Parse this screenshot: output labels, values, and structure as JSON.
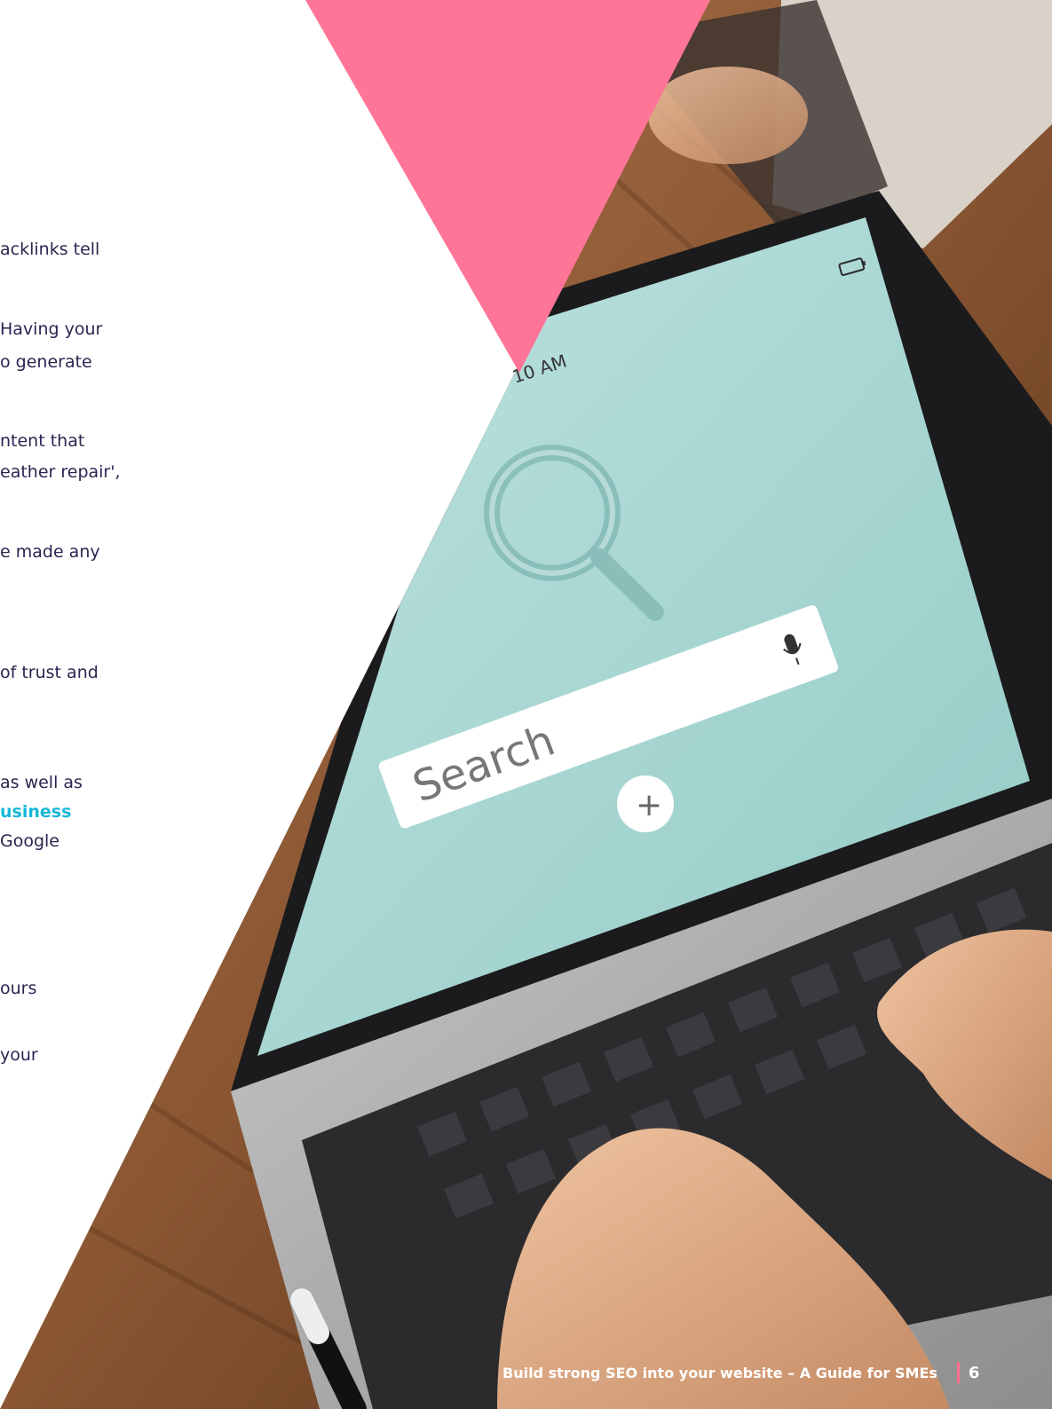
{
  "text_fragments": [
    "acklinks tell",
    "Having your",
    "o generate",
    "ntent that",
    "eather repair',",
    "e made any",
    "of trust and",
    "as well as",
    "usiness",
    " Google",
    "ours",
    "your"
  ],
  "screen": {
    "time": "10 AM",
    "search_placeholder": "Search",
    "add_button": "+"
  },
  "footer": {
    "title": "Build strong SEO into your website – A Guide for SMEs",
    "page_number": "6"
  },
  "colors": {
    "brand_pink": "#ff7597",
    "accent_cyan": "#17b7d8",
    "text_navy": "#2b2450",
    "screen_teal": "#a5d6d2"
  },
  "icons": [
    "battery-icon",
    "search-magnifier-icon",
    "microphone-icon",
    "plus-icon"
  ]
}
